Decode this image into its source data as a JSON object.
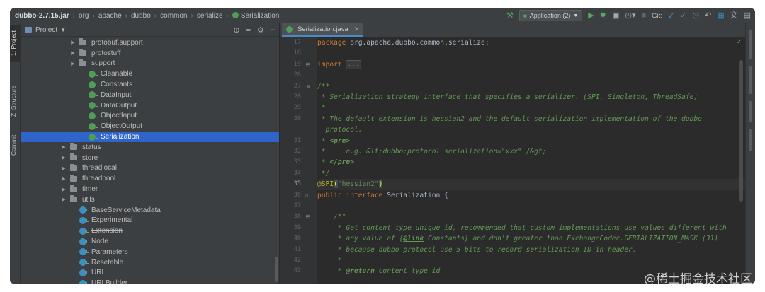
{
  "breadcrumbs": [
    "dubbo-2.7.15.jar",
    "org",
    "apache",
    "dubbo",
    "common",
    "serialize",
    "Serialization"
  ],
  "toolbar": {
    "run_config": "Application (2)",
    "git_label": "Git:",
    "icons": [
      "hammer-icon",
      "run-icon",
      "debug-icon",
      "coverage-icon",
      "profile-icon",
      "stop-icon",
      "git-update-icon",
      "git-commit-icon",
      "history-icon",
      "rollback-icon",
      "project-structure-icon",
      "translate-icon",
      "layout-icon"
    ]
  },
  "left_tabs": [
    "1: Project",
    "Z: Structure",
    "Commit"
  ],
  "project": {
    "title": "Project",
    "tree": [
      {
        "label": "protobuf.support",
        "type": "folder",
        "indent": 5,
        "collapsed": true
      },
      {
        "label": "protostuff",
        "type": "folder",
        "indent": 5,
        "collapsed": true
      },
      {
        "label": "support",
        "type": "folder",
        "indent": 5,
        "collapsed": true
      },
      {
        "label": "Cleanable",
        "type": "class",
        "indent": 6
      },
      {
        "label": "Constants",
        "type": "class",
        "indent": 6
      },
      {
        "label": "DataInput",
        "type": "class",
        "indent": 6
      },
      {
        "label": "DataOutput",
        "type": "class",
        "indent": 6
      },
      {
        "label": "ObjectInput",
        "type": "class",
        "indent": 6
      },
      {
        "label": "ObjectOutput",
        "type": "class",
        "indent": 6
      },
      {
        "label": "Serialization",
        "type": "class",
        "indent": 6,
        "selected": true
      },
      {
        "label": "status",
        "type": "folder",
        "indent": 4,
        "collapsed": true
      },
      {
        "label": "store",
        "type": "folder",
        "indent": 4,
        "collapsed": true
      },
      {
        "label": "threadlocal",
        "type": "folder",
        "indent": 4,
        "collapsed": true
      },
      {
        "label": "threadpool",
        "type": "folder",
        "indent": 4,
        "collapsed": true
      },
      {
        "label": "timer",
        "type": "folder",
        "indent": 4,
        "collapsed": true
      },
      {
        "label": "utils",
        "type": "folder",
        "indent": 4,
        "collapsed": true
      },
      {
        "label": "BaseServiceMetadata",
        "type": "class-blue",
        "indent": 5
      },
      {
        "label": "Experimental",
        "type": "class-blue",
        "indent": 5
      },
      {
        "label": "Extension",
        "type": "class-blue",
        "indent": 5,
        "deprecated": true
      },
      {
        "label": "Node",
        "type": "class-blue",
        "indent": 5
      },
      {
        "label": "Parameters",
        "type": "class-blue",
        "indent": 5,
        "deprecated": true
      },
      {
        "label": "Resetable",
        "type": "class-blue",
        "indent": 5
      },
      {
        "label": "URL",
        "type": "class-blue",
        "indent": 5
      },
      {
        "label": "URLBuilder",
        "type": "class-blue",
        "indent": 5
      }
    ]
  },
  "editor": {
    "tab": "Serialization.java",
    "current_line": "35",
    "lines": [
      {
        "n": "17",
        "segs": [
          [
            "kw",
            "package "
          ],
          [
            "",
            "org.apache.dubbo.common.serialize;"
          ]
        ]
      },
      {
        "n": "18",
        "segs": []
      },
      {
        "n": "19",
        "segs": [
          [
            "kw",
            "import "
          ],
          [
            "fold",
            "..."
          ]
        ]
      },
      {
        "n": "26",
        "segs": []
      },
      {
        "n": "27",
        "segs": [
          [
            "cm",
            "/**"
          ]
        ]
      },
      {
        "n": "28",
        "segs": [
          [
            "cm",
            " * Serialization strategy interface that specifies a serializer. (SPI, Singleton, ThreadSafe)"
          ]
        ]
      },
      {
        "n": "29",
        "segs": [
          [
            "cm",
            " *"
          ]
        ]
      },
      {
        "n": "30",
        "segs": [
          [
            "cm",
            " * The default extension is hessian2 and the default serialization implementation of the dubbo"
          ]
        ]
      },
      {
        "n": "",
        "segs": [
          [
            "cm",
            "  protocol."
          ]
        ]
      },
      {
        "n": "31",
        "segs": [
          [
            "cm",
            " * "
          ],
          [
            "tag",
            "<pre>"
          ]
        ]
      },
      {
        "n": "32",
        "segs": [
          [
            "cm",
            " *     e.g. &lt;dubbo:protocol serialization=\"xxx\" /&gt;"
          ]
        ]
      },
      {
        "n": "33",
        "segs": [
          [
            "cm",
            " * "
          ],
          [
            "tag",
            "</pre>"
          ]
        ]
      },
      {
        "n": "34",
        "segs": [
          [
            "cm",
            " */"
          ]
        ]
      },
      {
        "n": "35",
        "segs": [
          [
            "ann",
            "@SPI"
          ],
          [
            "bracket",
            "("
          ],
          [
            "str",
            "\"hessian2\""
          ],
          [
            "bracket",
            ")"
          ]
        ]
      },
      {
        "n": "36",
        "segs": [
          [
            "kw",
            "public interface "
          ],
          [
            "",
            "Serialization {"
          ]
        ]
      },
      {
        "n": "37",
        "segs": []
      },
      {
        "n": "38",
        "segs": [
          [
            "cm",
            "    /**"
          ]
        ]
      },
      {
        "n": "39",
        "segs": [
          [
            "cm",
            "     * Get content type unique id, recommended that custom implementations use values different with"
          ]
        ]
      },
      {
        "n": "40",
        "segs": [
          [
            "cm",
            "     * any value of {"
          ],
          [
            "tag",
            "@link"
          ],
          [
            "cm",
            " Constants} and don't greater than ExchangeCodec.SERIALIZATION_MASK (31)"
          ]
        ]
      },
      {
        "n": "41",
        "segs": [
          [
            "cm",
            "     * because dubbo protocol use 5 bits to record serialization ID in header."
          ]
        ]
      },
      {
        "n": "42",
        "segs": [
          [
            "cm",
            "     *"
          ]
        ]
      },
      {
        "n": "43",
        "segs": [
          [
            "cm",
            "     * "
          ],
          [
            "tag",
            "@return"
          ],
          [
            "cm",
            " content type id"
          ]
        ]
      }
    ]
  },
  "watermark": "@稀土掘金技术社区"
}
